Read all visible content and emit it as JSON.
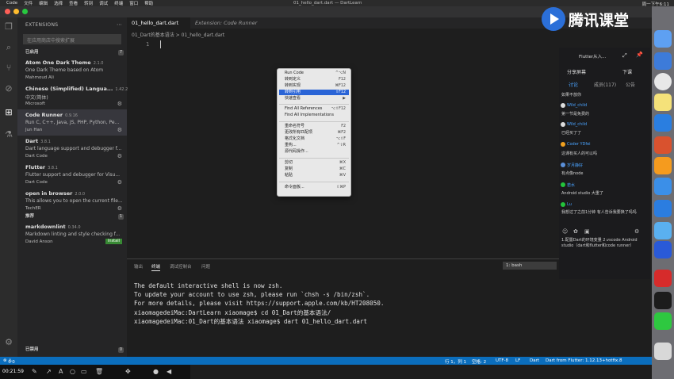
{
  "menubar": {
    "items": [
      "Code",
      "文件",
      "编辑",
      "选择",
      "查看",
      "转到",
      "调试",
      "终端",
      "窗口",
      "帮助"
    ],
    "title": "01_hello_dart.dart — DartLearn",
    "right": "周一下午6:11"
  },
  "sidebar": {
    "title": "EXTENSIONS",
    "search_placeholder": "在应用商店中搜索扩展",
    "installed_label": "已启用",
    "installed_count": "7",
    "recommended_label": "推荐",
    "recommended_count": "1",
    "disabled_label": "已禁用",
    "disabled_count": "0",
    "extensions": [
      {
        "name": "Atom One Dark Theme",
        "version": "2.1.0",
        "desc": "One Dark Theme based on Atom",
        "publisher": "Mahmoud Ali"
      },
      {
        "name": "Chinese (Simplified) Langua...",
        "version": "1.42.2",
        "desc": "中文(简体)",
        "publisher": "Microsoft"
      },
      {
        "name": "Code Runner",
        "version": "0.9.16",
        "desc": "Run C, C++, Java, JS, PHP, Python, Pe...",
        "publisher": "Jun Han"
      },
      {
        "name": "Dart",
        "version": "3.8.1",
        "desc": "Dart language support and debugger f...",
        "publisher": "Dart Code"
      },
      {
        "name": "Flutter",
        "version": "3.8.1",
        "desc": "Flutter support and debugger for Visu...",
        "publisher": "Dart Code"
      },
      {
        "name": "open in browser",
        "version": "2.0.0",
        "desc": "This allows you to open the current file...",
        "publisher": "TechER"
      }
    ],
    "recommended": [
      {
        "name": "markdownlint",
        "version": "0.34.0",
        "desc": "Markdown linting and style checking f...",
        "publisher": "David Anson",
        "action": "Install"
      }
    ]
  },
  "editor": {
    "tabs": [
      "01_hello_dart.dart",
      "Extension: Code Runner"
    ],
    "breadcrumb": "01_Dart的基本语法 > 01_hello_dart.dart",
    "line_number": "1"
  },
  "context_menu": {
    "items": [
      {
        "label": "Run Code",
        "shortcut": "^⌥N"
      },
      {
        "label": "转到定义",
        "shortcut": "F12"
      },
      {
        "label": "转到实现",
        "shortcut": "⌘F12"
      },
      {
        "label": "转到引用",
        "shortcut": "⇧F12",
        "highlighted": true
      },
      {
        "label": "快速查看",
        "shortcut": "▶"
      },
      {
        "label": "Find All References",
        "shortcut": "⌥⇧F12"
      },
      {
        "label": "Find All Implementations",
        "shortcut": ""
      },
      {
        "label": "重命名符号",
        "shortcut": "F2"
      },
      {
        "label": "更改所有匹配项",
        "shortcut": "⌘F2"
      },
      {
        "label": "格式化文档",
        "shortcut": "⌥⇧F"
      },
      {
        "label": "重构...",
        "shortcut": "^⇧R"
      },
      {
        "label": "源代码操作...",
        "shortcut": ""
      },
      {
        "label": "剪切",
        "shortcut": "⌘X"
      },
      {
        "label": "复制",
        "shortcut": "⌘C"
      },
      {
        "label": "粘贴",
        "shortcut": "⌘V"
      },
      {
        "label": "命令面板...",
        "shortcut": "⇧⌘P"
      }
    ]
  },
  "panel": {
    "tabs": [
      "输出",
      "终端",
      "调试控制台",
      "问题"
    ],
    "active_tab": "终端",
    "terminal_select": "1: bash",
    "lines": [
      "The default interactive shell is now zsh.",
      "To update your account to use zsh, please run `chsh -s /bin/zsh`.",
      "For more details, please visit https://support.apple.com/kb/HT208050.",
      "xiaomagedeiMac:DartLearn xiaomage$ cd 01_Dart的基本语法/",
      "xiaomagedeiMac:01_Dart的基本语法 xiaomage$ dart 01_hello_dart.dart "
    ]
  },
  "statusbar": {
    "errors": "0",
    "warnings": "0",
    "position": "行 1，列 1",
    "spaces": "空格: 2",
    "encoding": "UTF-8",
    "eol": "LF",
    "language": "Dart",
    "flutter": "Dart from Flutter: 1.12.13+hotfix.8"
  },
  "recorder": {
    "time": "00:21:59"
  },
  "chat": {
    "title": "Flutter从入...",
    "share": "分享屏幕",
    "leave": "下课",
    "tabs": [
      "讨论",
      "成员(117)",
      "公告"
    ],
    "messages": [
      {
        "user": "",
        "text": "如果不放你"
      },
      {
        "user": "Wild_child",
        "text": "第一节是免费的"
      },
      {
        "user": "Wild_child",
        "text": "已经买了了"
      },
      {
        "user": "Coder YDfei",
        "text": "这课有买人的可以吗"
      },
      {
        "user": "岁月静好",
        "text": "有点像node"
      },
      {
        "user": "若水",
        "text": "Android studio 大重了"
      },
      {
        "user": "Lu",
        "text": "我想过了之前1分钟 有人告诉我要换了吗吗"
      }
    ],
    "notice": "1.配置Dart的环境变量 2.vscode Android studio（dart和flutter和code runner）"
  },
  "watermark": {
    "text": "腾讯课堂"
  },
  "colors": {
    "statusbar": "#0b6ebd",
    "highlight": "#2a64d6",
    "install": "#388a34",
    "link": "#4aa3ff"
  }
}
